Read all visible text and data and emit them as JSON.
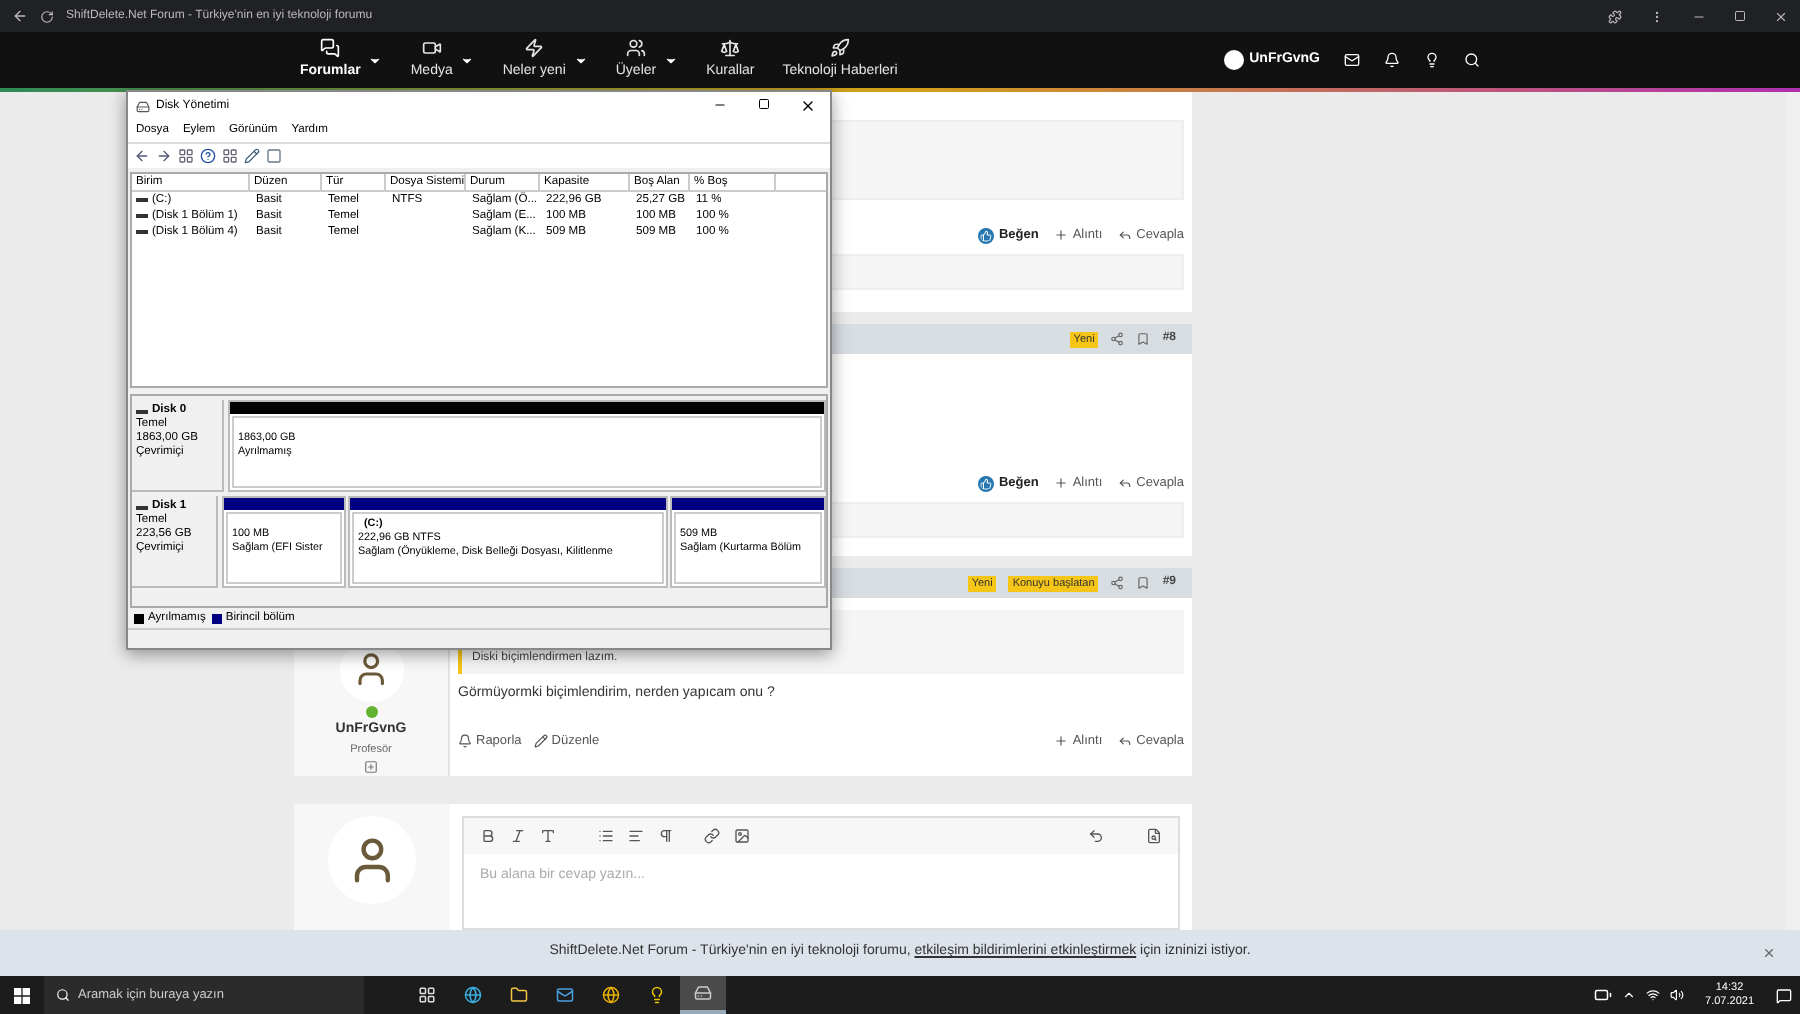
{
  "browser": {
    "title": "ShiftDelete.Net Forum - Türkiye'nin en iyi teknoloji forumu"
  },
  "nav": {
    "items": [
      {
        "kind": "forums",
        "label": "Forumlar",
        "selected": true,
        "dropdown": true
      },
      {
        "kind": "media",
        "label": "Medya",
        "selected": false,
        "dropdown": true
      },
      {
        "kind": "new",
        "label": "Neler yeni",
        "selected": false,
        "dropdown": true
      },
      {
        "kind": "members",
        "label": "Üyeler",
        "selected": false,
        "dropdown": true
      },
      {
        "kind": "rules",
        "label": "Kurallar",
        "selected": false,
        "dropdown": false
      },
      {
        "kind": "news",
        "label": "Teknoloji Haberleri",
        "selected": false,
        "dropdown": false
      }
    ],
    "user": "UnFrGvnG"
  },
  "posts": [
    {
      "actions": [
        {
          "kind": "like",
          "label": "Beğen"
        },
        {
          "kind": "quote",
          "label": "Alıntı"
        },
        {
          "kind": "reply",
          "label": "Cevapla"
        }
      ]
    },
    {
      "number": "#8",
      "badges": [
        "Yeni"
      ],
      "actions": [
        {
          "kind": "like",
          "label": "Beğen"
        },
        {
          "kind": "quote",
          "label": "Alıntı"
        },
        {
          "kind": "reply",
          "label": "Cevapla"
        }
      ]
    },
    {
      "number": "#9",
      "badges": [
        "Yeni",
        "Konuyu başlatan"
      ],
      "author": {
        "name": "UnFrGvnG",
        "title": "Profesör",
        "online": true
      },
      "quote": "Diski biçimlendirmen lazım.",
      "text": "Görmüyormki biçimlendirim, nerden yapıcam onu ?",
      "tools": [
        {
          "kind": "report",
          "label": "Raporla"
        },
        {
          "kind": "edit",
          "label": "Düzenle"
        }
      ],
      "actions": [
        {
          "kind": "quote",
          "label": "Alıntı"
        },
        {
          "kind": "reply",
          "label": "Cevapla"
        }
      ]
    }
  ],
  "editor": {
    "placeholder": "Bu alana bir cevap yazın..."
  },
  "disk_window": {
    "title": "Disk Yönetimi",
    "menu": [
      "Dosya",
      "Eylem",
      "Görünüm",
      "Yardım"
    ],
    "columns": [
      "Birim",
      "Düzen",
      "Tür",
      "Dosya Sistemi",
      "Durum",
      "Kapasite",
      "Boş Alan",
      "% Boş"
    ],
    "rows": [
      [
        "(C:)",
        "Basit",
        "Temel",
        "NTFS",
        "Sağlam (Ö...",
        "222,96 GB",
        "25,27 GB",
        "11 %"
      ],
      [
        "(Disk 1 Bölüm 1)",
        "Basit",
        "Temel",
        "",
        "Sağlam (E...",
        "100 MB",
        "100 MB",
        "100 %"
      ],
      [
        "(Disk 1 Bölüm 4)",
        "Basit",
        "Temel",
        "",
        "Sağlam (K...",
        "509 MB",
        "509 MB",
        "100 %"
      ]
    ],
    "disks": [
      {
        "name": "Disk 0",
        "type": "Temel",
        "size": "1863,00 GB",
        "status": "Çevrimiçi",
        "partitions": [
          {
            "size": "1863,00 GB",
            "status": "Ayrılmamış",
            "color": "#000000"
          }
        ]
      },
      {
        "name": "Disk 1",
        "type": "Temel",
        "size": "223,56 GB",
        "status": "Çevrimiçi",
        "partitions": [
          {
            "size": "100 MB",
            "status": "Sağlam (EFI Sister",
            "color": "#000080"
          },
          {
            "name": "(C:)",
            "size": "222,96 GB NTFS",
            "status": "Sağlam (Önyükleme, Disk Belleği Dosyası, Kilitlenme",
            "color": "#000080"
          },
          {
            "size": "509 MB",
            "status": "Sağlam (Kurtarma Bölüm",
            "color": "#000080"
          }
        ]
      }
    ],
    "legend": [
      {
        "label": "Ayrılmamış",
        "color": "#000000"
      },
      {
        "label": "Birincil bölüm",
        "color": "#000080"
      }
    ]
  },
  "notification": {
    "text": "ShiftDelete.Net Forum - Türkiye'nin en iyi teknoloji forumu, ",
    "link": "etkileşim bildirimlerini etkinleştirmek",
    "after": " için izninizi istiyor."
  },
  "taskbar": {
    "search_placeholder": "Aramak için buraya yazın",
    "apps": [
      {
        "kind": "taskview",
        "selected": false
      },
      {
        "kind": "edge",
        "selected": false
      },
      {
        "kind": "explorer",
        "selected": false
      },
      {
        "kind": "mail",
        "selected": false
      },
      {
        "kind": "chrome",
        "selected": false
      },
      {
        "kind": "app",
        "selected": false
      },
      {
        "kind": "disk",
        "selected": true
      }
    ],
    "time": "14:32",
    "date": "7.07.2021"
  }
}
